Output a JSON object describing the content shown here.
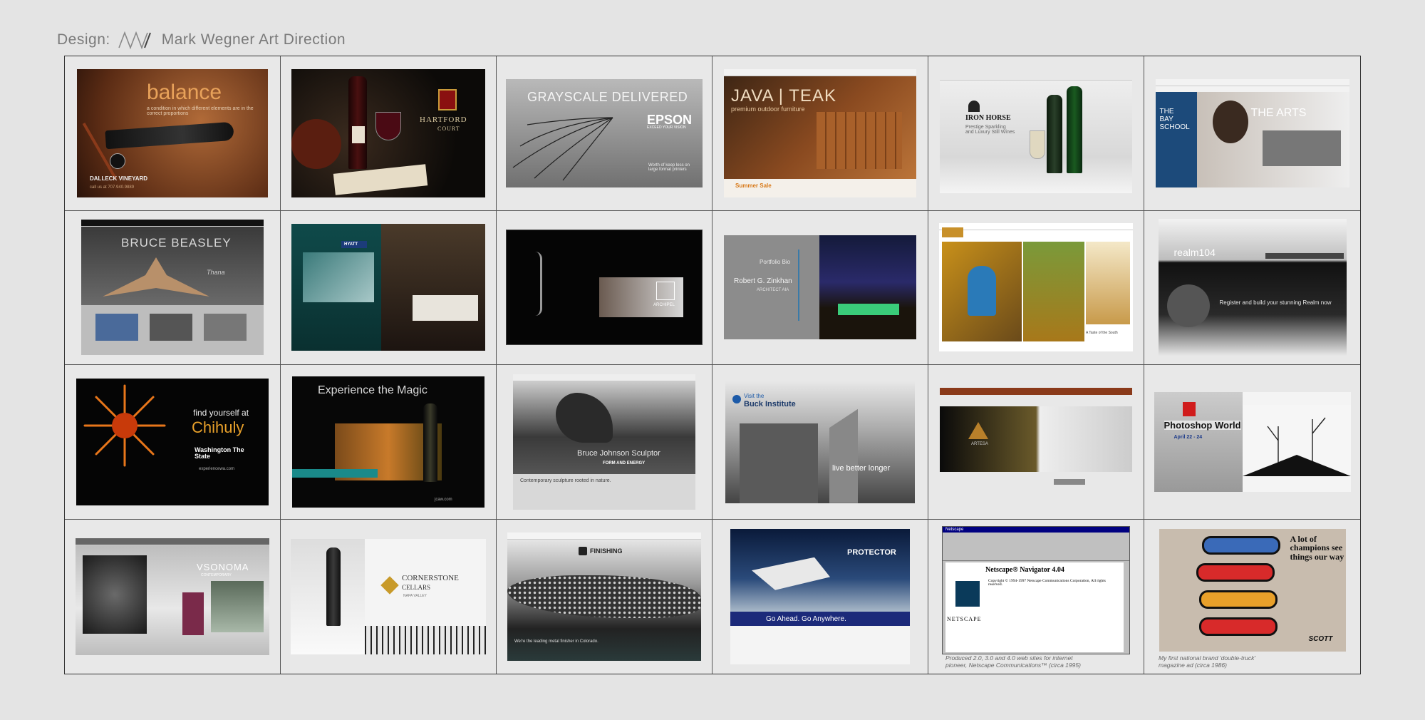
{
  "header": {
    "prefix": "Design:",
    "name": "Mark Wegner Art Direction"
  },
  "tiles": [
    {
      "id": "dalleck",
      "title": "balance",
      "tagline": "a condition in which different elements are in the correct proportions",
      "brand": "DALLECK VINEYARD",
      "sub": "call us at 707.940.9889"
    },
    {
      "id": "hartford",
      "brand": "HARTFORD",
      "sub": "COURT"
    },
    {
      "id": "epson",
      "title": "GRAYSCALE DELIVERED",
      "brand": "EPSON",
      "sub": "EXCEED YOUR VISION",
      "note": "Worth of keep less on large format printers"
    },
    {
      "id": "javateak",
      "title": "JAVA | TEAK",
      "sub": "premium outdoor furniture",
      "promo": "Summer Sale"
    },
    {
      "id": "ironhorse",
      "brand": "IRON HORSE",
      "sub": "Prestige Sparkling and Luxury Still Wines"
    },
    {
      "id": "bayschool",
      "brand": "THE BAY SCHOOL",
      "title": "THE ARTS"
    },
    {
      "id": "beasley",
      "title": "BRUCE BEASLEY",
      "sub": "Thana"
    },
    {
      "id": "hyatt",
      "brand": "HYATT"
    },
    {
      "id": "archipel",
      "brand": "ARCHIPEL"
    },
    {
      "id": "zinkhan",
      "title": "Portfolio  Bio",
      "name": "Robert G. Zinkhan",
      "sub": "ARCHITECT AIA"
    },
    {
      "id": "winery",
      "sub": "A Taste of the South"
    },
    {
      "id": "realm",
      "brand": "realm104",
      "sub": "Register and build your stunning Realm now"
    },
    {
      "id": "chihuly",
      "title": "find yourself at",
      "brand": "Chihuly",
      "sub": "Washington The State",
      "url": "experiencewa.com"
    },
    {
      "id": "magic",
      "title": "Experience the Magic",
      "sub": "jcaw.com"
    },
    {
      "id": "bruce",
      "title": "Bruce Johnson  Sculptor",
      "sub": "FORM AND ENERGY",
      "body": "Contemporary sculpture rooted in nature."
    },
    {
      "id": "buck",
      "title": "Visit the",
      "brand": "Buck Institute",
      "sub": "live better longer"
    },
    {
      "id": "artesa",
      "brand": "ARTESA"
    },
    {
      "id": "photoshop",
      "brand": "Photoshop World",
      "sub": "April 22 - 24"
    },
    {
      "id": "vsonoma",
      "brand": "VSONOMA",
      "sub": "CONTEMPORARY"
    },
    {
      "id": "cornerstone",
      "brand": "CORNERSTONE",
      "sub": "CELLARS",
      "place": "NAPA VALLEY"
    },
    {
      "id": "finishing",
      "brand": "FINISHING",
      "body": "We're the leading metal finisher in Colorado."
    },
    {
      "id": "protector",
      "brand": "PROTECTOR",
      "sub": "Go Ahead. Go Anywhere."
    },
    {
      "id": "netscape",
      "window": "Netscape",
      "title": "Netscape® Navigator 4.04",
      "copy": "Copyright © 1994-1997 Netscape Communications Corporation, All rights reserved.",
      "brand": "NETSCAPE",
      "caption": "Produced 2.0, 3.0 and 4.0 web sites for internet\npioneer, Netscape Communications™ (circa 1995)"
    },
    {
      "id": "scott",
      "title": "A lot of champions see things our way",
      "brand": "SCOTT",
      "caption": "My first national brand 'double-truck'\nmagazine ad (circa 1986)"
    }
  ]
}
